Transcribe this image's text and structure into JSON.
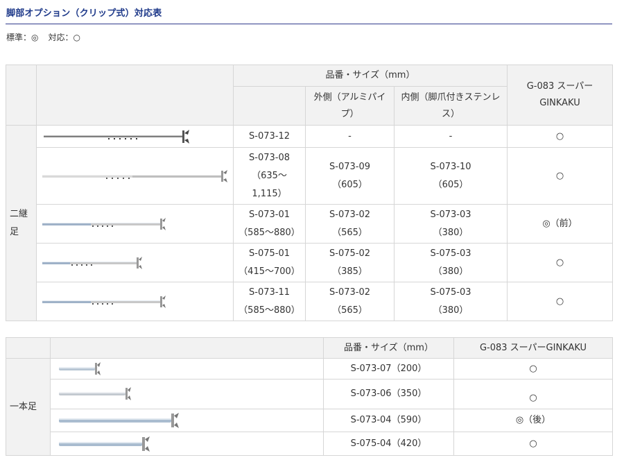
{
  "page": {
    "title": "脚部オプション（クリップ式）対応表",
    "legend_standard": "標準：◎",
    "legend_compatible": "対応：○"
  },
  "table1": {
    "header_product": "品番・サイズ（mm）",
    "header_outer": "外側（アルミパイプ）",
    "header_inner": "内側（脚爪付きステンレス）",
    "header_model": "G-083 スーパーGINKAKU",
    "group_label": "二継足",
    "rows": [
      {
        "main": "S-073-12",
        "main_size": "",
        "outer": "-",
        "outer_size": "",
        "inner": "-",
        "inner_size": "",
        "mark": "○"
      },
      {
        "main": "S-073-08",
        "main_size": "（635〜1,115）",
        "outer": "S-073-09",
        "outer_size": "（605）",
        "inner": "S-073-10",
        "inner_size": "（605）",
        "mark": "○"
      },
      {
        "main": "S-073-01",
        "main_size": "（585〜880）",
        "outer": "S-073-02",
        "outer_size": "（565）",
        "inner": "S-073-03",
        "inner_size": "（380）",
        "mark": "◎（前）"
      },
      {
        "main": "S-075-01",
        "main_size": "（415〜700）",
        "outer": "S-075-02",
        "outer_size": "（385）",
        "inner": "S-075-03",
        "inner_size": "（380）",
        "mark": "○"
      },
      {
        "main": "S-073-11",
        "main_size": "（585〜880）",
        "outer": "S-073-02",
        "outer_size": "（565）",
        "inner": "S-075-03",
        "inner_size": "（380）",
        "mark": "○"
      }
    ]
  },
  "table2": {
    "header_product": "品番・サイズ（mm）",
    "header_model": "G-083 スーパーGINKAKU",
    "group_label": "一本足",
    "rows": [
      {
        "product": "S-073-07（200）",
        "mark": "○"
      },
      {
        "product": "S-073-06（350）",
        "mark": "○"
      },
      {
        "product": "S-073-04（590）",
        "mark": "◎（後）"
      },
      {
        "product": "S-075-04（420）",
        "mark": "○"
      }
    ]
  },
  "colors": {
    "title": "#1f3a8a",
    "header_bg": "#f2f2f2",
    "border": "#d6d6d6"
  }
}
